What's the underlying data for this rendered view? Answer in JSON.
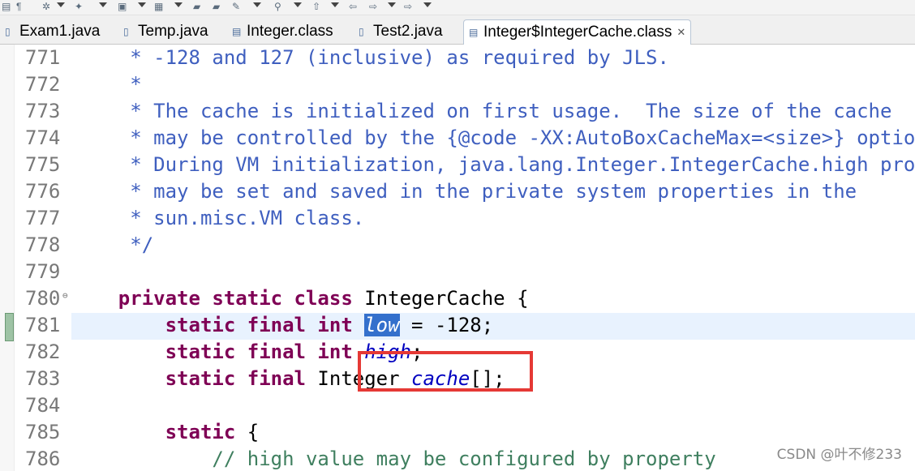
{
  "toolbar": {
    "icons": [
      "file-icon",
      "run-icon",
      "debug-icon",
      "build-icon",
      "open-folder-icon",
      "folder-icon",
      "wand-icon",
      "search-icon",
      "up-icon",
      "back-icon",
      "forward-icon",
      "next-icon"
    ]
  },
  "tabs": [
    {
      "label": "Exam1.java",
      "active": false
    },
    {
      "label": "Temp.java",
      "active": false
    },
    {
      "label": "Integer.class",
      "active": false
    },
    {
      "label": "Test2.java",
      "active": false
    },
    {
      "label": "Integer$IntegerCache.class",
      "active": true,
      "close": "✕"
    }
  ],
  "editor": {
    "lines": [
      {
        "num": "771",
        "segs": [
          [
            "cmt",
            "     * -128 and 127 (inclusive) as required by JLS."
          ]
        ]
      },
      {
        "num": "772",
        "segs": [
          [
            "cmt",
            "     *"
          ]
        ]
      },
      {
        "num": "773",
        "segs": [
          [
            "cmt",
            "     * The cache is initialized on first usage.  The size of the cache"
          ]
        ]
      },
      {
        "num": "774",
        "segs": [
          [
            "cmt",
            "     * may be controlled by the {@code -XX:AutoBoxCacheMax=<size>} option."
          ]
        ]
      },
      {
        "num": "775",
        "segs": [
          [
            "cmt",
            "     * During VM initialization, java.lang.Integer.IntegerCache.high property"
          ]
        ]
      },
      {
        "num": "776",
        "segs": [
          [
            "cmt",
            "     * may be set and saved in the private system properties in the"
          ]
        ]
      },
      {
        "num": "777",
        "segs": [
          [
            "cmt",
            "     * sun.misc.VM class."
          ]
        ]
      },
      {
        "num": "778",
        "segs": [
          [
            "cmt",
            "     */"
          ]
        ]
      },
      {
        "num": "779",
        "segs": []
      },
      {
        "num": "780",
        "fold": "⊖",
        "segs": [
          [
            "pl",
            "    "
          ],
          [
            "kw",
            "private static class"
          ],
          [
            "pl",
            " IntegerCache {"
          ]
        ]
      },
      {
        "num": "781",
        "segs": [
          [
            "pl",
            "        "
          ],
          [
            "kw",
            "static final int"
          ],
          [
            "pl",
            " "
          ],
          [
            "sel",
            "low"
          ],
          [
            "pl",
            " = -128;"
          ]
        ]
      },
      {
        "num": "782",
        "segs": [
          [
            "pl",
            "        "
          ],
          [
            "kw",
            "static final int"
          ],
          [
            "pl",
            " "
          ],
          [
            "fld",
            "high"
          ],
          [
            "pl",
            ";"
          ]
        ]
      },
      {
        "num": "783",
        "segs": [
          [
            "pl",
            "        "
          ],
          [
            "kw",
            "static final"
          ],
          [
            "pl",
            " Integer "
          ],
          [
            "fld",
            "cache"
          ],
          [
            "pl",
            "[];"
          ]
        ]
      },
      {
        "num": "784",
        "segs": []
      },
      {
        "num": "785",
        "segs": [
          [
            "pl",
            "        "
          ],
          [
            "kw",
            "static"
          ],
          [
            "pl",
            " {"
          ]
        ]
      },
      {
        "num": "786",
        "segs": [
          [
            "lc",
            "            // high value may be configured by property"
          ]
        ]
      }
    ]
  },
  "watermark": "CSDN @叶不修233",
  "colors": {
    "comment": "#3f5fbf",
    "keyword": "#7f0055",
    "field": "#0000c0",
    "selection": "#3470cc",
    "current_line": "#e8f2fe",
    "highlight_box": "#e53935"
  }
}
